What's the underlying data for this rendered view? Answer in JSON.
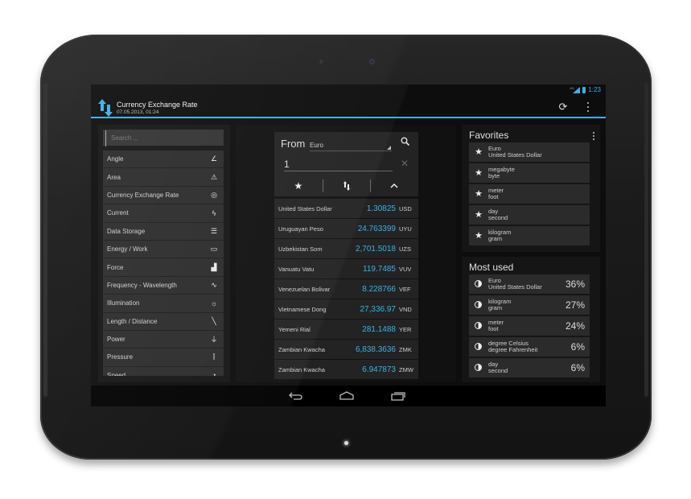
{
  "status_bar": {
    "network": "4G",
    "time": "1:23"
  },
  "action_bar": {
    "title": "Currency Exchange Rate",
    "subtitle": "07.05.2013, 01:24",
    "icons": {
      "app": "up-down-arrows-icon",
      "refresh": "refresh-icon",
      "overflow": "overflow-menu-icon"
    }
  },
  "categories": {
    "search_placeholder": "Search ...",
    "items": [
      {
        "label": "Angle",
        "icon": "angle-icon",
        "glyph": "∠"
      },
      {
        "label": "Area",
        "icon": "area-icon",
        "glyph": "⚠"
      },
      {
        "label": "Currency Exchange Rate",
        "icon": "coin-icon",
        "glyph": "◎"
      },
      {
        "label": "Current",
        "icon": "lightning-icon",
        "glyph": "ϟ"
      },
      {
        "label": "Data Storage",
        "icon": "database-icon",
        "glyph": "☰"
      },
      {
        "label": "Energy / Work",
        "icon": "battery-icon",
        "glyph": "▭"
      },
      {
        "label": "Force",
        "icon": "force-icon",
        "glyph": "▟"
      },
      {
        "label": "Frequency - Wavelength",
        "icon": "wave-icon",
        "glyph": "∿"
      },
      {
        "label": "Illumination",
        "icon": "lightbulb-icon",
        "glyph": "☼"
      },
      {
        "label": "Length / Distance",
        "icon": "ruler-icon",
        "glyph": "╲"
      },
      {
        "label": "Power",
        "icon": "plug-icon",
        "glyph": "⏚"
      },
      {
        "label": "Pressure",
        "icon": "pressure-icon",
        "glyph": "Ī"
      },
      {
        "label": "Speed",
        "icon": "speed-icon",
        "glyph": "◔"
      }
    ]
  },
  "converter": {
    "from_label": "From",
    "from_unit": "Euro",
    "amount": "1",
    "icons": {
      "search": "search-icon",
      "clear": "clear-icon",
      "favorite": "star-icon",
      "swap": "swap-icon",
      "collapse": "chevron-up-icon"
    },
    "rates": [
      {
        "name": "United States Dollar",
        "value": "1.30825",
        "code": "USD"
      },
      {
        "name": "Uruguayan Peso",
        "value": "24.763399",
        "code": "UYU"
      },
      {
        "name": "Uzbekistan Som",
        "value": "2,701.5018",
        "code": "UZS"
      },
      {
        "name": "Vanuatu Vatu",
        "value": "119.7485",
        "code": "VUV"
      },
      {
        "name": "Venezuelan Bolivar",
        "value": "8.228766",
        "code": "VEF"
      },
      {
        "name": "Vietnamese Dong",
        "value": "27,336.97",
        "code": "VND"
      },
      {
        "name": "Yemeni Rial",
        "value": "281.1488",
        "code": "YER"
      },
      {
        "name": "Zambian Kwacha",
        "value": "6,838.3636",
        "code": "ZMK"
      },
      {
        "name": "Zambian Kwacha",
        "value": "6.947873",
        "code": "ZMW"
      }
    ]
  },
  "favorites": {
    "title": "Favorites",
    "items": [
      {
        "from": "Euro",
        "to": "United States Dollar"
      },
      {
        "from": "megabyte",
        "to": "byte"
      },
      {
        "from": "meter",
        "to": "foot"
      },
      {
        "from": "day",
        "to": "second"
      },
      {
        "from": "kilogram",
        "to": "gram"
      }
    ]
  },
  "most_used": {
    "title": "Most used",
    "items": [
      {
        "from": "Euro",
        "to": "United States Dollar",
        "percent": "36%"
      },
      {
        "from": "kilogram",
        "to": "gram",
        "percent": "27%"
      },
      {
        "from": "meter",
        "to": "foot",
        "percent": "24%"
      },
      {
        "from": "degree Celsius",
        "to": "degree Fahrenheit",
        "percent": "6%"
      },
      {
        "from": "day",
        "to": "second",
        "percent": "6%"
      }
    ]
  },
  "nav_bar": {
    "back": "back-icon",
    "home": "home-icon",
    "recents": "recent-apps-icon"
  },
  "colors": {
    "accent": "#33b5e5"
  }
}
